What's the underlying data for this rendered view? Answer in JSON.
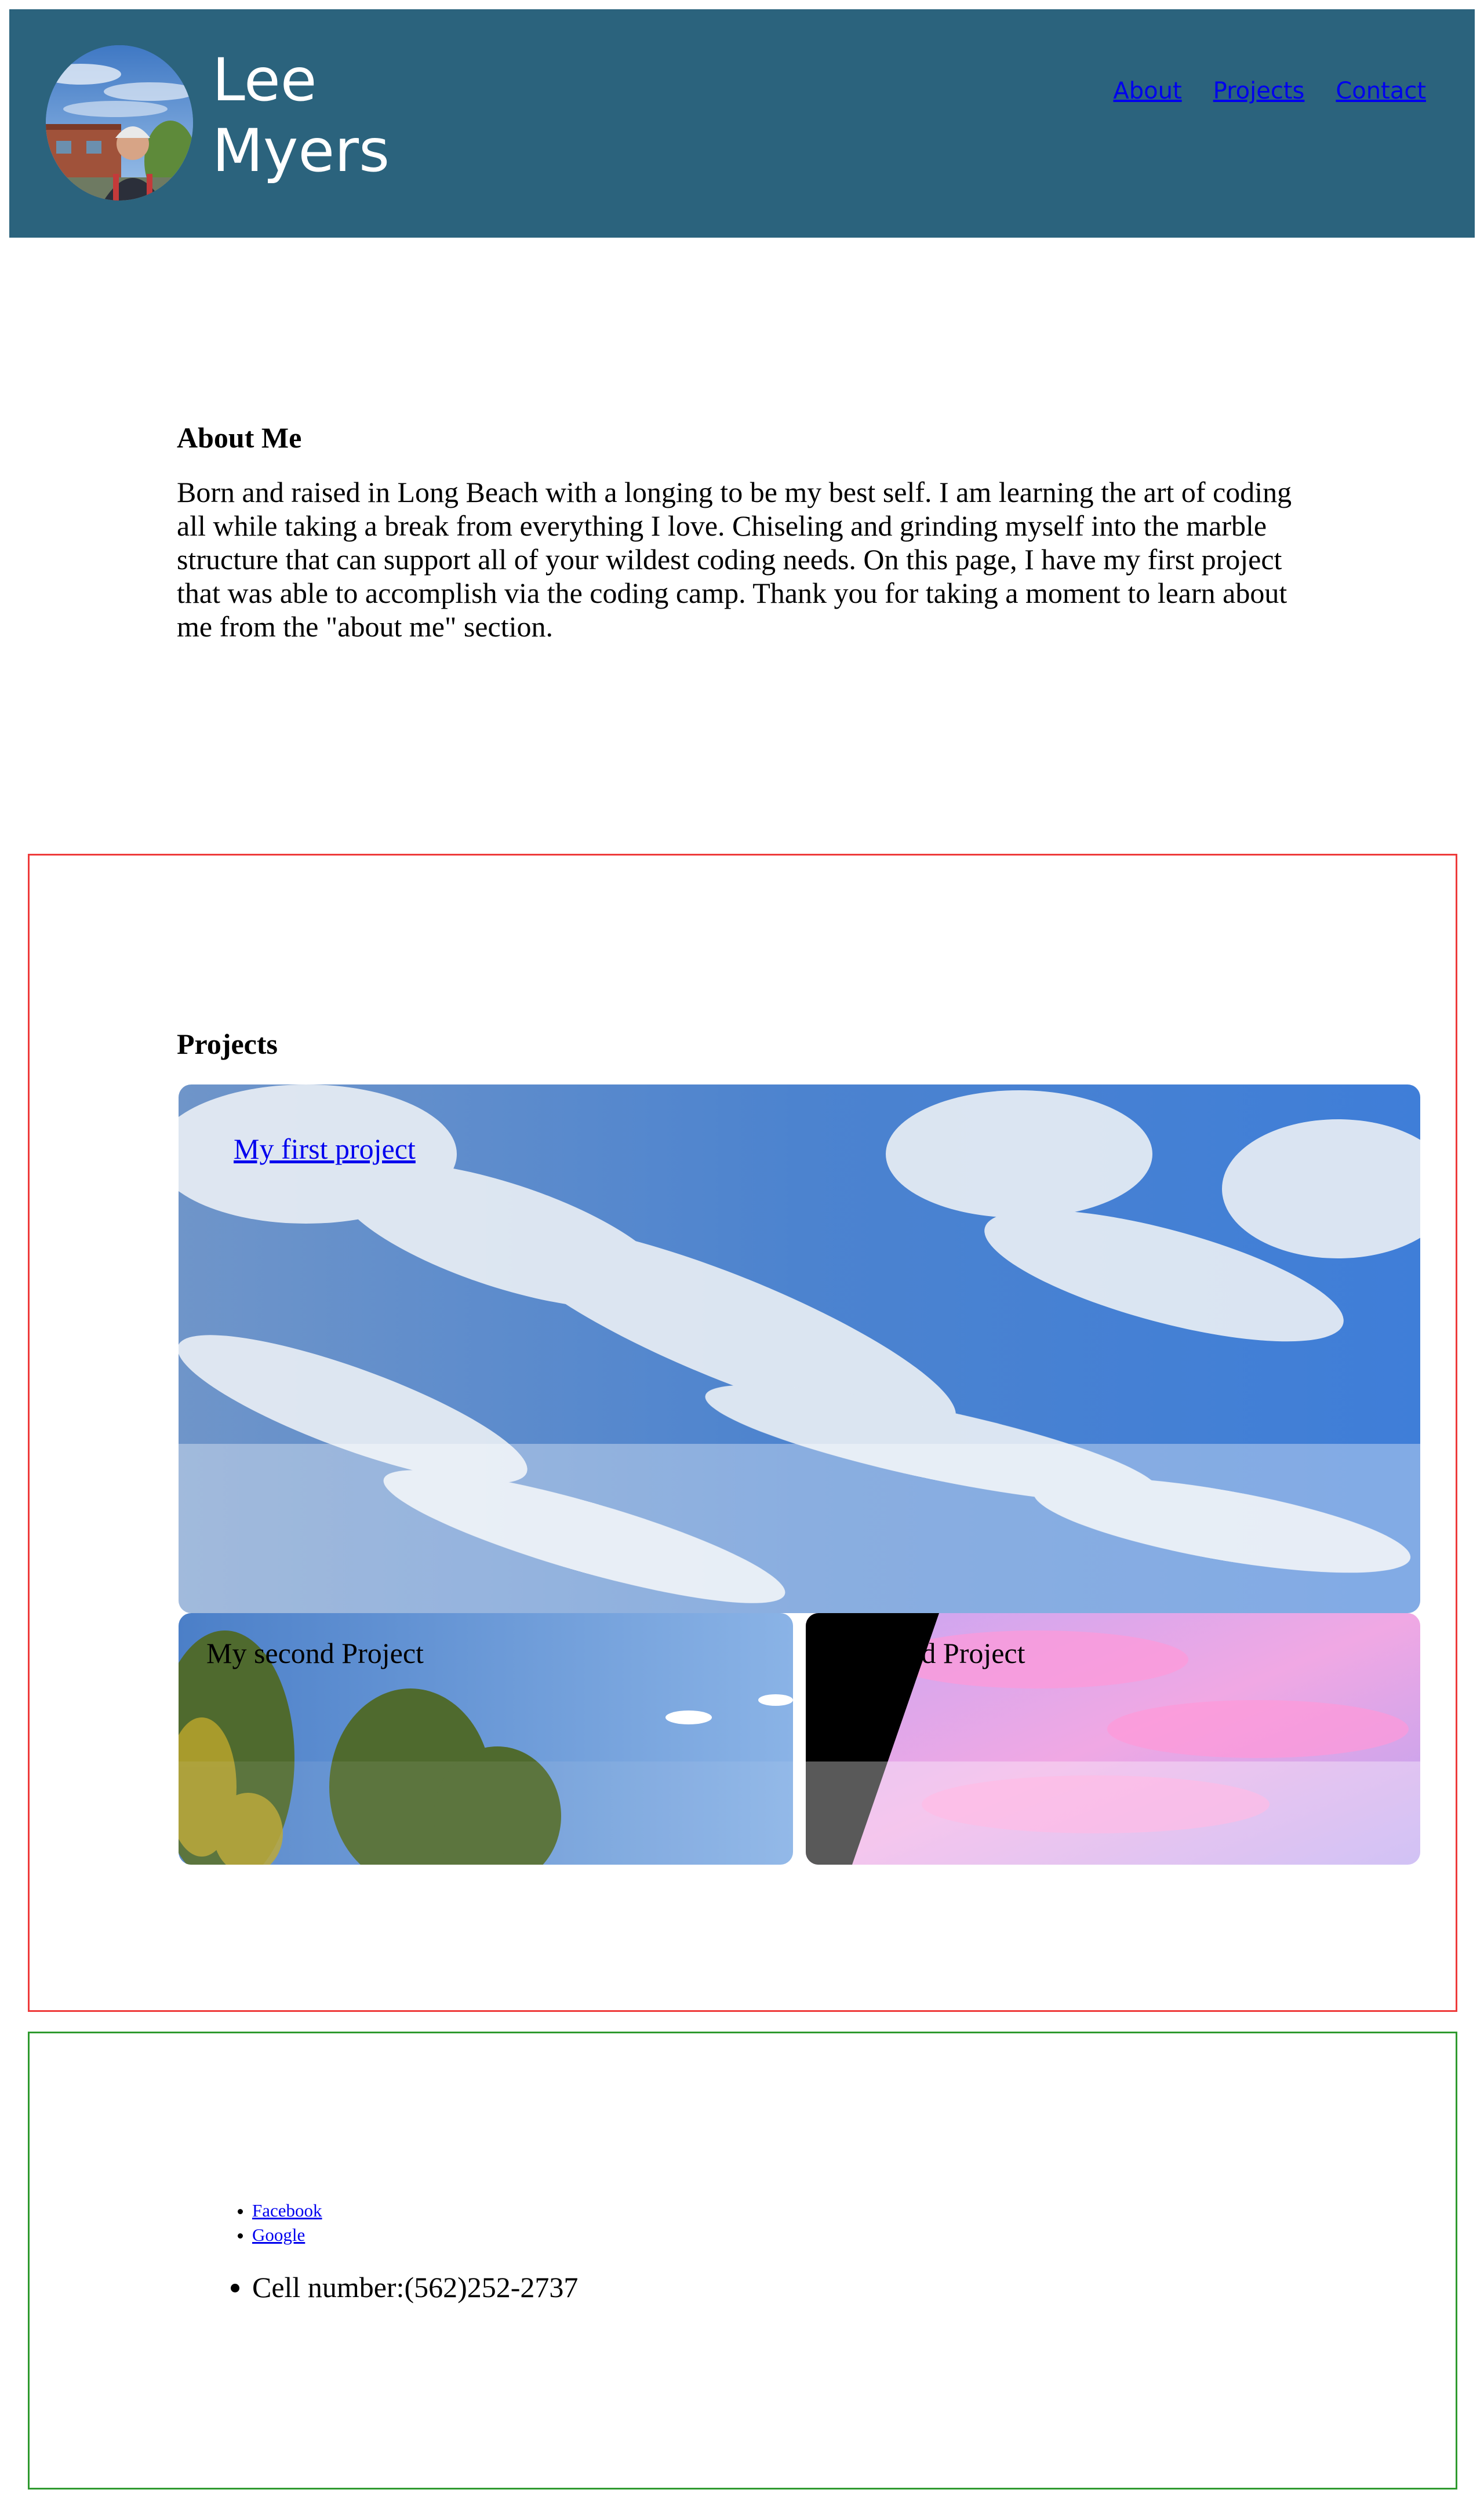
{
  "header": {
    "title": "Lee Myers",
    "avatar_alt": "profile photo",
    "nav": [
      {
        "label": "About"
      },
      {
        "label": "Projects"
      },
      {
        "label": "Contact"
      }
    ]
  },
  "about": {
    "heading": "About Me",
    "body": "Born and raised in Long Beach with a longing to be my best self. I am learning the art of coding all while taking a break from everything I love. Chiseling and grinding myself into the marble structure that can support all of your wildest coding needs. On this page, I have my first project that was able to accomplish via the coding camp. Thank you for taking a moment to learn about me from the \"about me\" section."
  },
  "projects": {
    "heading": "Projects",
    "items": [
      {
        "label": "My first project",
        "image": "cloudy-sky"
      },
      {
        "label": "My second Project",
        "image": "trees-and-sky"
      },
      {
        "label": "My third Project",
        "image": "pink-sunset-sky"
      }
    ]
  },
  "contact": {
    "links": [
      {
        "label": "Facebook"
      },
      {
        "label": "Google"
      }
    ],
    "phone": "Cell number:(562)252-2737"
  },
  "colors": {
    "header_bg": "#2b637d",
    "projects_border": "#ee3b3b",
    "contact_border": "#2f9a2f",
    "link": "#0000ee"
  }
}
